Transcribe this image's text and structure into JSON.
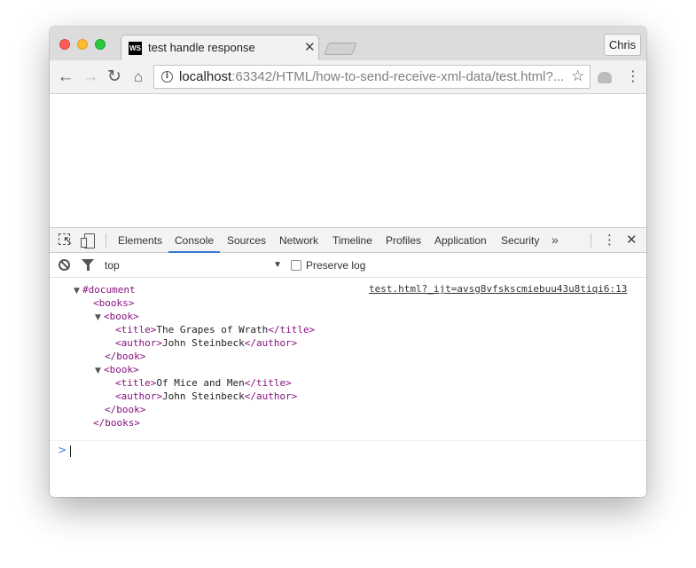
{
  "window": {
    "tab": {
      "favicon_text": "WS",
      "title": "test handle response"
    },
    "profile_label": "Chris"
  },
  "toolbar": {
    "url_host": "localhost",
    "url_rest": ":63342/HTML/how-to-send-receive-xml-data/test.html?...",
    "icons": [
      "back-icon",
      "forward-icon",
      "reload-icon",
      "home-icon",
      "info-icon",
      "star-icon",
      "extension-icon",
      "menu-icon"
    ]
  },
  "devtools": {
    "tabs": [
      "Elements",
      "Console",
      "Sources",
      "Network",
      "Timeline",
      "Profiles",
      "Application",
      "Security"
    ],
    "active_tab": "Console",
    "more_label": "»",
    "context": "top",
    "preserve_log_label": "Preserve log",
    "preserve_log_checked": false,
    "accent_color": "#3879d9"
  },
  "console": {
    "source_link": "test.html?_ijt=avsg8vfskscmiebuu43u8tiqi6:13",
    "lines": [
      {
        "tri": "▼",
        "tag_open": "#document",
        "text": "",
        "tag_close": ""
      },
      {
        "tri": "",
        "tag_open": "<books>",
        "text": "",
        "tag_close": ""
      },
      {
        "tri": "▼",
        "tag_open": "<book>",
        "text": "",
        "tag_close": ""
      },
      {
        "tri": "",
        "tag_open": "<title>",
        "text": "The Grapes of Wrath",
        "tag_close": "</title>"
      },
      {
        "tri": "",
        "tag_open": "<author>",
        "text": "John Steinbeck",
        "tag_close": "</author>"
      },
      {
        "tri": "",
        "tag_open": "</book>",
        "text": "",
        "tag_close": ""
      },
      {
        "tri": "▼",
        "tag_open": "<book>",
        "text": "",
        "tag_close": ""
      },
      {
        "tri": "",
        "tag_open": "<title>",
        "text": "Of Mice and Men",
        "tag_close": "</title>"
      },
      {
        "tri": "",
        "tag_open": "<author>",
        "text": "John Steinbeck",
        "tag_close": "</author>"
      },
      {
        "tri": "",
        "tag_open": "</book>",
        "text": "",
        "tag_close": ""
      },
      {
        "tri": "",
        "tag_open": "</books>",
        "text": "",
        "tag_close": ""
      }
    ],
    "prompt_symbol": ">"
  }
}
